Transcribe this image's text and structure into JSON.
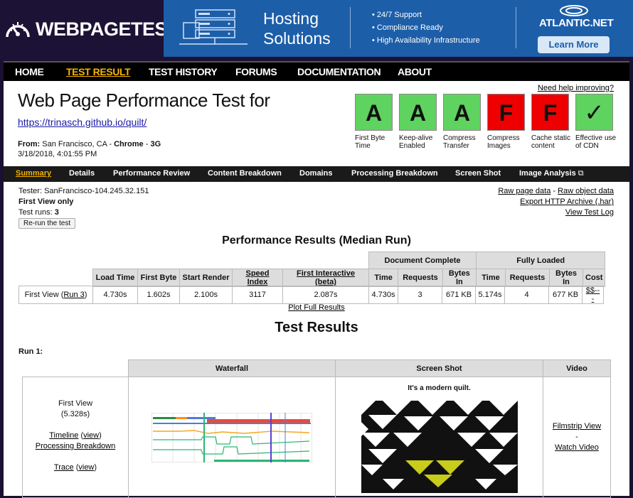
{
  "logo": {
    "text": "WEBPAGETEST"
  },
  "ad": {
    "title": "Hosting Solutions",
    "bullets": [
      "24/7 Support",
      "Compliance Ready",
      "High Availability Infrastructure"
    ],
    "brand": "ATLANTIC.NET",
    "button": "Learn More"
  },
  "nav": {
    "items": [
      "HOME",
      "TEST RESULT",
      "TEST HISTORY",
      "FORUMS",
      "DOCUMENTATION",
      "ABOUT"
    ],
    "active": "TEST RESULT"
  },
  "header": {
    "title": "Web Page Performance Test for",
    "url": "https://trinasch.github.io/quilt/",
    "from_label": "From:",
    "from_location": "San Francisco, CA - ",
    "browser": "Chrome",
    "connection": "3G",
    "datetime": "3/18/2018, 4:01:55 PM",
    "help": "Need help improving?"
  },
  "grades": [
    {
      "grade": "A",
      "label": "First Byte Time",
      "color": "#5fd35f"
    },
    {
      "grade": "A",
      "label": "Keep-alive Enabled",
      "color": "#5fd35f"
    },
    {
      "grade": "A",
      "label": "Compress Transfer",
      "color": "#5fd35f"
    },
    {
      "grade": "F",
      "label": "Compress Images",
      "color": "#ee0000"
    },
    {
      "grade": "F",
      "label": "Cache static content",
      "color": "#ee0000"
    },
    {
      "grade": "✓",
      "label": "Effective use of CDN",
      "color": "#5fd35f"
    }
  ],
  "subnav": {
    "items": [
      "Summary",
      "Details",
      "Performance Review",
      "Content Breakdown",
      "Domains",
      "Processing Breakdown",
      "Screen Shot",
      "Image Analysis"
    ],
    "active": "Summary"
  },
  "tester": {
    "line1": "Tester: SanFrancisco-104.245.32.151",
    "line2": "First View only",
    "runs_label": "Test runs: ",
    "runs": "3",
    "rerun": "Re-run the test"
  },
  "links": {
    "raw_page": "Raw page data",
    "sep": " - ",
    "raw_object": "Raw object data",
    "har": "Export HTTP Archive (.har)",
    "log": "View Test Log"
  },
  "perf": {
    "heading": "Performance Results (Median Run)",
    "group_doc": "Document Complete",
    "group_full": "Fully Loaded",
    "cols": [
      "Load Time",
      "First Byte",
      "Start Render",
      "Speed Index",
      "First Interactive (beta)",
      "Time",
      "Requests",
      "Bytes In",
      "Time",
      "Requests",
      "Bytes In",
      "Cost"
    ],
    "row_label": "First View (",
    "row_link": "Run 3",
    "row_close": ")",
    "values": [
      "4.730s",
      "1.602s",
      "2.100s",
      "3117",
      "2.087s",
      "4.730s",
      "3",
      "671 KB",
      "5.174s",
      "4",
      "677 KB",
      "$$---"
    ],
    "plot_full": "Plot Full Results"
  },
  "results": {
    "heading": "Test Results",
    "run_label": "Run 1:",
    "cols": [
      "Waterfall",
      "Screen Shot",
      "Video"
    ],
    "first_view": "First View",
    "load_time": "(5.328s)",
    "timeline": "Timeline",
    "view": "view",
    "processing": "Processing Breakdown",
    "trace": "Trace",
    "filmstrip": "Filmstrip View",
    "dash": "-",
    "watch": "Watch Video",
    "screenshot_caption": "It's a modern quilt."
  }
}
